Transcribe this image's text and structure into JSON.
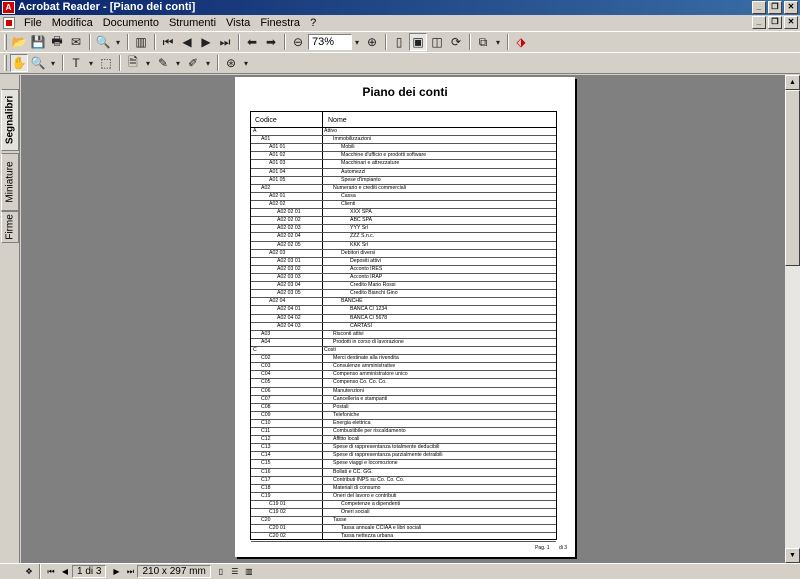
{
  "window": {
    "title": "Acrobat Reader - [Piano dei conti]"
  },
  "menu": [
    "File",
    "Modifica",
    "Documento",
    "Strumenti",
    "Vista",
    "Finestra",
    "?"
  ],
  "toolbar": {
    "zoom": "73%"
  },
  "side_tabs": [
    "Segnalibri",
    "Miniature",
    "Firme"
  ],
  "document": {
    "title": "Piano dei conti",
    "columns": [
      "Codice",
      "Nome"
    ],
    "rows": [
      {
        "code": "A",
        "name": "Attivo",
        "level": 0
      },
      {
        "code": "A01",
        "name": "Immobilizzazioni",
        "level": 1
      },
      {
        "code": "A01 01",
        "name": "Mobili",
        "level": 2
      },
      {
        "code": "A01 02",
        "name": "Macchine d'ufficio e prodotti software",
        "level": 2
      },
      {
        "code": "A01 03",
        "name": "Macchinari e attrezzature",
        "level": 2
      },
      {
        "code": "A01 04",
        "name": "Automezzi",
        "level": 2
      },
      {
        "code": "A01 05",
        "name": "Spese d'impianto",
        "level": 2
      },
      {
        "code": "A02",
        "name": "Numerario e crediti commerciali",
        "level": 1
      },
      {
        "code": "A02 01",
        "name": "Cassa",
        "level": 2
      },
      {
        "code": "A02 02",
        "name": "Clienti",
        "level": 2
      },
      {
        "code": "A02 02 01",
        "name": "XXX SPA",
        "level": 3
      },
      {
        "code": "A02 02 02",
        "name": "ABC SPA",
        "level": 3
      },
      {
        "code": "A02 02 03",
        "name": "YYY Srl",
        "level": 3
      },
      {
        "code": "A02 02 04",
        "name": "ZZZ S.n.c.",
        "level": 3
      },
      {
        "code": "A02 02 05",
        "name": "KKK Srl",
        "level": 3
      },
      {
        "code": "A02 03",
        "name": "Debitori diversi",
        "level": 2
      },
      {
        "code": "A02 03 01",
        "name": "Depositi attivi",
        "level": 3
      },
      {
        "code": "A02 03 02",
        "name": "Acconto IRES",
        "level": 3
      },
      {
        "code": "A02 03 03",
        "name": "Acconto IRAP",
        "level": 3
      },
      {
        "code": "A02 03 04",
        "name": "Credito Mario Rossi",
        "level": 3
      },
      {
        "code": "A02 03 05",
        "name": "Credito Bianchi Gino",
        "level": 3
      },
      {
        "code": "A02 04",
        "name": "BANCHE",
        "level": 2
      },
      {
        "code": "A02 04 01",
        "name": "BANCA C/ 1234",
        "level": 3
      },
      {
        "code": "A02 04 02",
        "name": "BANCA C/ 5678",
        "level": 3
      },
      {
        "code": "A02 04 03",
        "name": "CARTASI",
        "level": 3
      },
      {
        "code": "A03",
        "name": "Risconti attivi",
        "level": 1
      },
      {
        "code": "A04",
        "name": "Prodotti in corso di lavorazione",
        "level": 1
      },
      {
        "code": "C",
        "name": "Costi",
        "level": 0
      },
      {
        "code": "C02",
        "name": "Merci destinate alla rivendita",
        "level": 1
      },
      {
        "code": "C03",
        "name": "Consulenze amministrative",
        "level": 1
      },
      {
        "code": "C04",
        "name": "Compenso amministratore unico",
        "level": 1
      },
      {
        "code": "C05",
        "name": "Compenso Co. Co. Co.",
        "level": 1
      },
      {
        "code": "C06",
        "name": "Manutenzioni",
        "level": 1
      },
      {
        "code": "C07",
        "name": "Cancelleria e stampanti",
        "level": 1
      },
      {
        "code": "C08",
        "name": "Postali",
        "level": 1
      },
      {
        "code": "C09",
        "name": "Telefoniche",
        "level": 1
      },
      {
        "code": "C10",
        "name": "Energia elettrica",
        "level": 1
      },
      {
        "code": "C11",
        "name": "Combustibile per riscaldamento",
        "level": 1
      },
      {
        "code": "C12",
        "name": "Affitto locali",
        "level": 1
      },
      {
        "code": "C13",
        "name": "Spese di rappresentanza totalmente deducibili",
        "level": 1
      },
      {
        "code": "C14",
        "name": "Spese di rappresentanza parzialmente detraibili",
        "level": 1
      },
      {
        "code": "C15",
        "name": "Spese viaggi e locomozione",
        "level": 1
      },
      {
        "code": "C16",
        "name": "Bollati e CC. GG.",
        "level": 1
      },
      {
        "code": "C17",
        "name": "Contributi INPS su Co. Co. Co.",
        "level": 1
      },
      {
        "code": "C18",
        "name": "Materiali di consumo",
        "level": 1
      },
      {
        "code": "C19",
        "name": "Oneri del lavoro e contributi",
        "level": 1
      },
      {
        "code": "C19 01",
        "name": "Competenze a dipendenti",
        "level": 2
      },
      {
        "code": "C19 02",
        "name": "Oneri sociali",
        "level": 2
      },
      {
        "code": "C20",
        "name": "Tasse",
        "level": 1
      },
      {
        "code": "C20 01",
        "name": "Tassa annuale CCIAA e libri sociali",
        "level": 2
      },
      {
        "code": "C20 02",
        "name": "Tassa nettezza urbana",
        "level": 2
      }
    ],
    "footer_page": "Pag. 1",
    "footer_of": "di 3"
  },
  "status": {
    "page": "1 di 3",
    "size": "210 x 297 mm"
  }
}
